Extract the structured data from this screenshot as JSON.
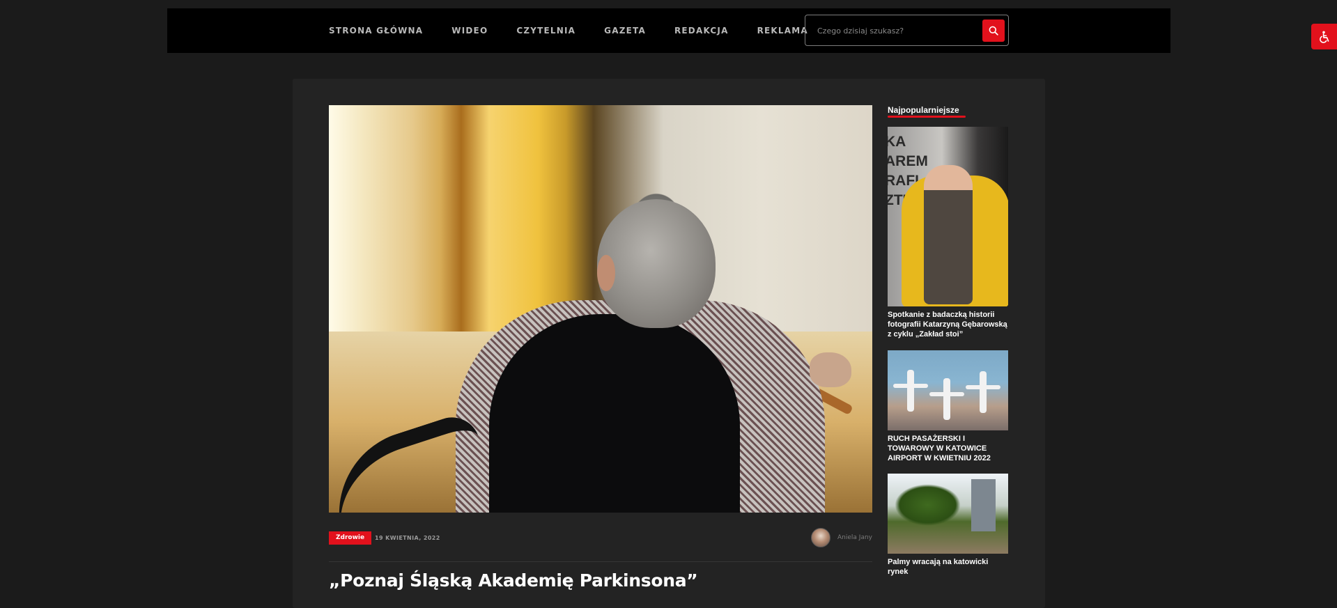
{
  "nav": {
    "items": [
      "STRONA GŁÓWNA",
      "WIDEO",
      "CZYTELNIA",
      "GAZETA",
      "REDAKCJA",
      "REKLAMA"
    ],
    "search_placeholder": "Czego dzisiaj szukasz?"
  },
  "accent_color": "#e2111c",
  "article": {
    "category": "Zdrowie",
    "date": "19 KWIETNIA, 2022",
    "author": "Aniela Jany",
    "title": "„Poznaj Śląską Akademię Parkinsona”"
  },
  "sidebar": {
    "heading": "Najpopularniejsze",
    "posts": [
      {
        "title": "Spotkanie z badaczką historii fotografii Katarzyną Gębarowską z cyklu „Zakład stoi”",
        "image_text": [
          "KA",
          "AREM",
          "RAFI",
          "ZTUKA"
        ]
      },
      {
        "title": "RUCH PASAŻERSKI I TOWAROWY W KATOWICE AIRPORT W KWIETNIU 2022"
      },
      {
        "title": "Palmy wracają na katowicki rynek"
      }
    ]
  }
}
